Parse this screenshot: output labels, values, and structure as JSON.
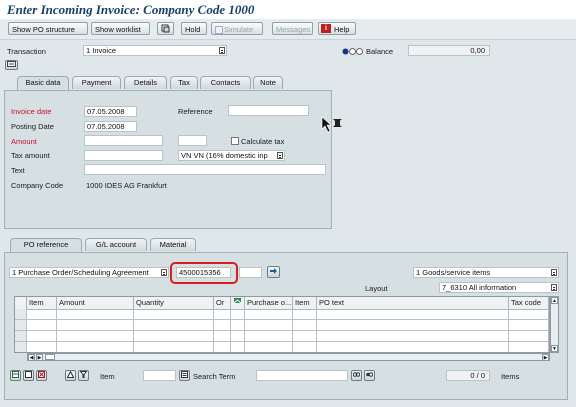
{
  "window_title": "Enter Incoming Invoice: Company Code 1000",
  "toolbar": {
    "buttons": [
      "Show PO structure",
      "Show worklist",
      "",
      "Hold",
      "Simulate",
      "Messages",
      "Help"
    ],
    "simulate": "Simulate",
    "messages": "Messages",
    "help": "Help",
    "hold": "Hold"
  },
  "transaction": {
    "label": "Transaction",
    "value": "1 Invoice"
  },
  "balance": {
    "label": "Balance",
    "value": "0,00"
  },
  "header_tabs": [
    "Basic data",
    "Payment",
    "Details",
    "Tax",
    "Contacts",
    "Note"
  ],
  "basic_data": {
    "invoice_date_label": "Invoice date",
    "invoice_date": "07.05.2008",
    "reference_label": "Reference",
    "reference": "",
    "posting_date_label": "Posting Date",
    "posting_date": "07.05.2008",
    "amount_label": "Amount",
    "amount": "",
    "calculate_tax_label": "Calculate tax",
    "tax_amount_label": "Tax amount",
    "tax_amount": "",
    "tax_code": "VN VN (16% domestic inp",
    "text_label": "Text",
    "text": "",
    "company_code_label": "Company Code",
    "company_code": "1000 IDES AG Frankfurt"
  },
  "ref_tabs": [
    "PO reference",
    "G/L account",
    "Material"
  ],
  "po_reference": {
    "doc_type": "1 Purchase Order/Scheduling Agreement",
    "po_number": "4500015356",
    "item_type": "1 Goods/service items",
    "layout_label": "Layout",
    "layout": "7_6310 All information"
  },
  "grid": {
    "columns": [
      "Item",
      "Amount",
      "Quantity",
      "Or",
      "",
      "Purchase o...",
      "Item",
      "PO text",
      "Tax code"
    ]
  },
  "footer": {
    "item_label": "Item",
    "search_term_label": "Search Term",
    "count": "0 / 0",
    "items_label": "Items"
  },
  "colors": {
    "highlight": "#d81e1e",
    "title": "#17406d",
    "required_label": "#c8102e"
  }
}
